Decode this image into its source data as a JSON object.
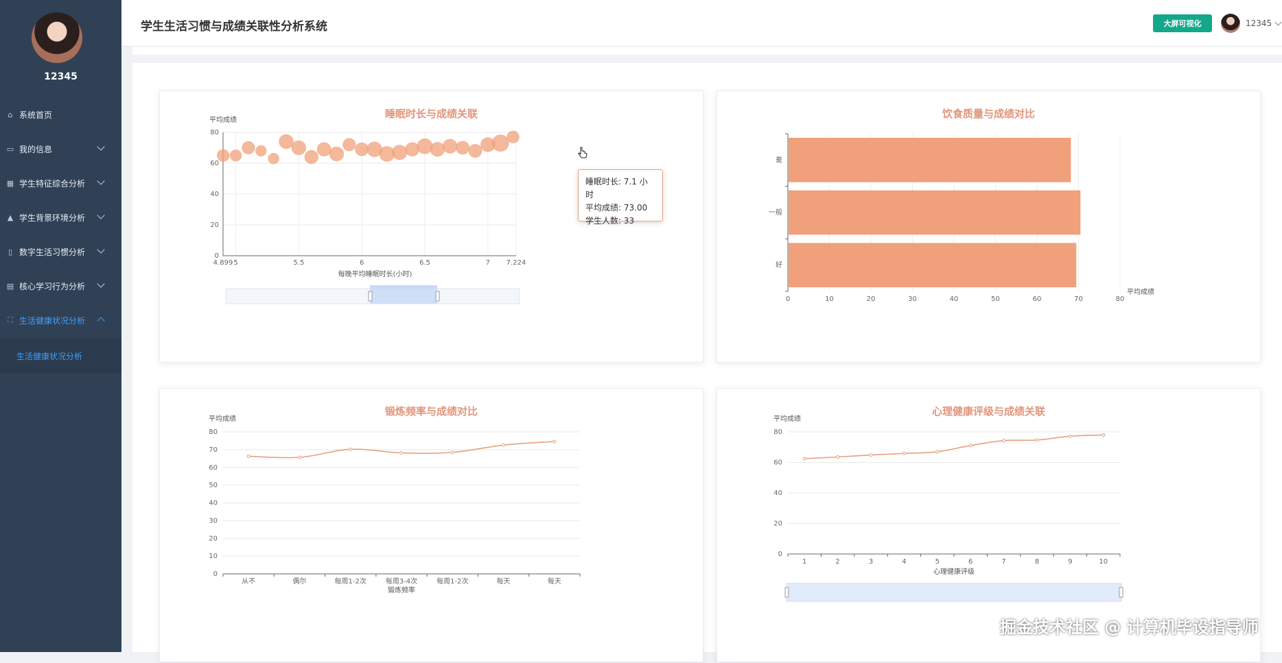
{
  "sidebar": {
    "username": "12345",
    "items": [
      {
        "label": "系统首页",
        "icon": "home-icon"
      },
      {
        "label": "我的信息",
        "icon": "id-card-icon"
      },
      {
        "label": "学生特征综合分析",
        "icon": "grid-icon"
      },
      {
        "label": "学生背景环境分析",
        "icon": "school-icon"
      },
      {
        "label": "数字生活习惯分析",
        "icon": "phone-icon"
      },
      {
        "label": "核心学习行为分析",
        "icon": "chart-icon"
      },
      {
        "label": "生活健康状况分析",
        "icon": "fullscreen-icon"
      }
    ],
    "submenu": "生活健康状况分析"
  },
  "header": {
    "title": "学生生活习惯与成绩关联性分析系统",
    "bigscreen_label": "大屏可视化",
    "username": "12345"
  },
  "tooltip": {
    "line1": "睡眠时长: 7.1 小时",
    "line2": "平均成绩: 73.00",
    "line3": "学生人数: 33"
  },
  "watermark": "掘金技术社区 @ 计算机毕设指导师",
  "colors": {
    "sidebar": "#304156",
    "accent": "#409eff",
    "chart": "#f0a07a",
    "title": "#e2967c",
    "button": "#13a88b"
  },
  "chart_data": [
    {
      "type": "scatter",
      "title": "睡眠时长与成绩关联",
      "xlabel": "每晚平均睡眠时长(小时)",
      "ylabel": "平均成绩",
      "xlim": [
        4.899,
        7.224
      ],
      "ylim": [
        0,
        80
      ],
      "xticks": [
        "4.899",
        "5",
        "5.5",
        "6",
        "6.5",
        "7",
        "7.224"
      ],
      "yticks": [
        0,
        20,
        40,
        60,
        80
      ],
      "points": [
        {
          "x": 4.9,
          "y": 65,
          "n": 14
        },
        {
          "x": 5.0,
          "y": 65,
          "n": 12
        },
        {
          "x": 5.1,
          "y": 70,
          "n": 16
        },
        {
          "x": 5.2,
          "y": 68,
          "n": 10
        },
        {
          "x": 5.3,
          "y": 63,
          "n": 10
        },
        {
          "x": 5.4,
          "y": 74,
          "n": 22
        },
        {
          "x": 5.5,
          "y": 70,
          "n": 22
        },
        {
          "x": 5.6,
          "y": 64,
          "n": 19
        },
        {
          "x": 5.7,
          "y": 69,
          "n": 20
        },
        {
          "x": 5.8,
          "y": 66,
          "n": 22
        },
        {
          "x": 5.9,
          "y": 72,
          "n": 16
        },
        {
          "x": 6.0,
          "y": 69,
          "n": 18
        },
        {
          "x": 6.1,
          "y": 69,
          "n": 25
        },
        {
          "x": 6.2,
          "y": 66,
          "n": 26
        },
        {
          "x": 6.3,
          "y": 67,
          "n": 24
        },
        {
          "x": 6.4,
          "y": 69,
          "n": 20
        },
        {
          "x": 6.5,
          "y": 71,
          "n": 26
        },
        {
          "x": 6.6,
          "y": 69,
          "n": 22
        },
        {
          "x": 6.7,
          "y": 71,
          "n": 22
        },
        {
          "x": 6.8,
          "y": 70,
          "n": 18
        },
        {
          "x": 6.9,
          "y": 68,
          "n": 18
        },
        {
          "x": 7.0,
          "y": 72,
          "n": 22
        },
        {
          "x": 7.1,
          "y": 73,
          "n": 33
        },
        {
          "x": 7.2,
          "y": 77,
          "n": 14
        }
      ]
    },
    {
      "type": "bar",
      "orientation": "horizontal",
      "title": "饮食质量与成绩对比",
      "xlabel": "平均成绩",
      "categories": [
        "差",
        "一般",
        "好"
      ],
      "values": [
        68,
        70.3,
        69.3
      ],
      "xlim": [
        0,
        80
      ],
      "xticks": [
        0,
        10,
        20,
        30,
        40,
        50,
        60,
        70,
        80
      ]
    },
    {
      "type": "line",
      "title": "锻炼频率与成绩对比",
      "xlabel": "锻炼频率",
      "ylabel": "平均成绩",
      "categories": [
        "从不",
        "偶尔",
        "每周1-2次",
        "每周3-4次",
        "每周1-2次",
        "每天",
        "每天"
      ],
      "values": [
        66.3,
        65.7,
        70.2,
        68.2,
        68.5,
        72.6,
        74.6
      ],
      "ylim": [
        0,
        80
      ],
      "yticks": [
        0,
        10,
        20,
        30,
        40,
        50,
        60,
        70,
        80
      ]
    },
    {
      "type": "line",
      "title": "心理健康评级与成绩关联",
      "xlabel": "心理健康评级",
      "ylabel": "平均成绩",
      "categories": [
        "1",
        "2",
        "3",
        "4",
        "5",
        "6",
        "7",
        "8",
        "9",
        "10"
      ],
      "values": [
        62.5,
        63.6,
        64.9,
        65.9,
        67.0,
        71.1,
        74.3,
        74.7,
        77.2,
        78.0
      ],
      "ylim": [
        0,
        80
      ],
      "yticks": [
        0,
        20,
        40,
        60,
        80
      ]
    }
  ]
}
